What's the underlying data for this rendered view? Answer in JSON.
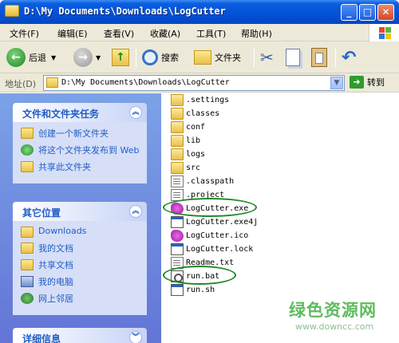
{
  "window": {
    "title": "D:\\My Documents\\Downloads\\LogCutter",
    "controls": {
      "minimize": "_",
      "maximize": "□",
      "close": "✕"
    }
  },
  "menu": {
    "items": [
      "文件(F)",
      "编辑(E)",
      "查看(V)",
      "收藏(A)",
      "工具(T)",
      "帮助(H)"
    ]
  },
  "toolbar": {
    "back_label": "后退",
    "search_label": "搜索",
    "folders_label": "文件夹"
  },
  "address": {
    "label": "地址(D)",
    "value": "D:\\My Documents\\Downloads\\LogCutter",
    "go_label": "转到"
  },
  "tasks_panel": {
    "title": "文件和文件夹任务",
    "items": [
      {
        "label": "创建一个新文件夹",
        "icon": "new-folder-icon"
      },
      {
        "label": "将这个文件夹发布到 Web",
        "icon": "publish-web-icon"
      },
      {
        "label": "共享此文件夹",
        "icon": "share-folder-icon"
      }
    ]
  },
  "places_panel": {
    "title": "其它位置",
    "items": [
      {
        "label": "Downloads",
        "icon": "folder-icon"
      },
      {
        "label": "我的文档",
        "icon": "folder-icon"
      },
      {
        "label": "共享文档",
        "icon": "folder-icon"
      },
      {
        "label": "我的电脑",
        "icon": "computer-icon"
      },
      {
        "label": "网上邻居",
        "icon": "network-icon"
      }
    ]
  },
  "details_panel": {
    "title": "详细信息"
  },
  "files": [
    {
      "name": ".settings",
      "type": "folder"
    },
    {
      "name": "classes",
      "type": "folder"
    },
    {
      "name": "conf",
      "type": "folder"
    },
    {
      "name": "lib",
      "type": "folder"
    },
    {
      "name": "logs",
      "type": "folder"
    },
    {
      "name": "src",
      "type": "folder"
    },
    {
      "name": ".classpath",
      "type": "doc"
    },
    {
      "name": ".project",
      "type": "doc"
    },
    {
      "name": "LogCutter.exe",
      "type": "ico"
    },
    {
      "name": "LogCutter.exe4j",
      "type": "app"
    },
    {
      "name": "LogCutter.ico",
      "type": "ico"
    },
    {
      "name": "LogCutter.lock",
      "type": "app"
    },
    {
      "name": "Readme.txt",
      "type": "doc"
    },
    {
      "name": "run.bat",
      "type": "bat"
    },
    {
      "name": "run.sh",
      "type": "app"
    }
  ],
  "watermark": {
    "title": "绿色资源网",
    "url": "www.downcc.com"
  },
  "colors": {
    "titlebar": "#0451d6",
    "link": "#215dc6",
    "highlight_ellipse": "#1e8a2a"
  }
}
